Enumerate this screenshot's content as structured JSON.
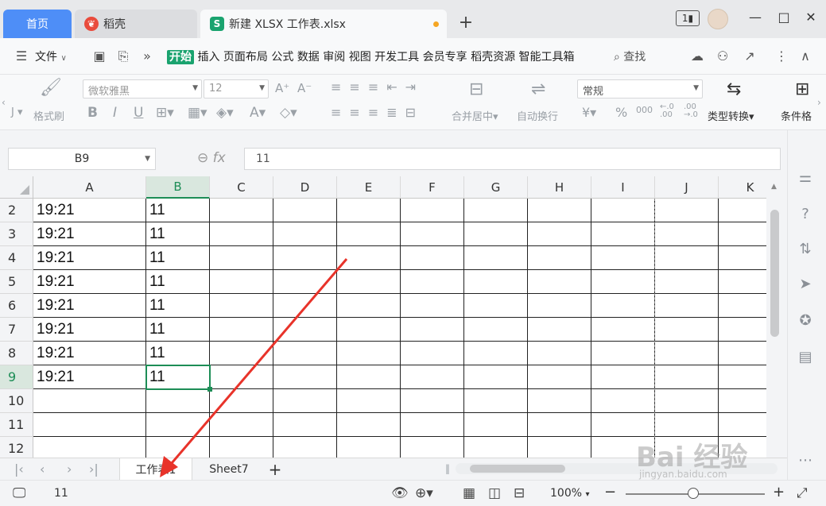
{
  "titlebar": {
    "home_tab": "首页",
    "tabs": [
      {
        "label": "稻壳",
        "icon": "daoke-icon",
        "color": "#e94b3c"
      },
      {
        "label": "新建 XLSX 工作表.xlsx",
        "icon": "spreadsheet-icon",
        "color": "#1aa36f"
      }
    ],
    "badge": "1",
    "minimize": "—",
    "maximize": "□",
    "close": "✕"
  },
  "menubar": {
    "file_label": "文件",
    "tabs": [
      "开始",
      "插入",
      "页面布局",
      "公式",
      "数据",
      "审阅",
      "视图",
      "开发工具",
      "会员专享",
      "稻壳资源",
      "智能工具箱"
    ],
    "active_tab": "开始",
    "search_label": "查找"
  },
  "ribbon": {
    "format_painter": "格式刷",
    "font_name": "微软雅黑",
    "font_size": "12",
    "merge_center": "合并居中",
    "wrap_text": "自动换行",
    "number_format": "常规",
    "type_convert": "类型转换",
    "conditional_format": "条件格"
  },
  "formula_bar": {
    "name_box": "B9",
    "formula": "11",
    "fx_label": "fx"
  },
  "grid": {
    "columns": [
      "A",
      "B",
      "C",
      "D",
      "E",
      "F",
      "G",
      "H",
      "I",
      "J",
      "K"
    ],
    "selected_column": "B",
    "rows": [
      {
        "num": "2",
        "a": "19:21",
        "b": "11"
      },
      {
        "num": "3",
        "a": "19:21",
        "b": "11"
      },
      {
        "num": "4",
        "a": "19:21",
        "b": "11"
      },
      {
        "num": "5",
        "a": "19:21",
        "b": "11"
      },
      {
        "num": "6",
        "a": "19:21",
        "b": "11"
      },
      {
        "num": "7",
        "a": "19:21",
        "b": "11"
      },
      {
        "num": "8",
        "a": "19:21",
        "b": "11"
      },
      {
        "num": "9",
        "a": "19:21",
        "b": "11"
      },
      {
        "num": "10",
        "a": "",
        "b": ""
      },
      {
        "num": "11",
        "a": "",
        "b": ""
      },
      {
        "num": "12",
        "a": "",
        "b": ""
      }
    ],
    "selected_row": "9"
  },
  "sheets": {
    "tabs": [
      "工作表1",
      "Sheet7"
    ],
    "active": "工作表1"
  },
  "statusbar": {
    "value": "11",
    "zoom": "100%"
  },
  "watermark": {
    "main": "Bai 经验",
    "sub": "jingyan.baidu.com"
  },
  "colors": {
    "accent": "#1d8d56",
    "home_tab": "#4e8ef7",
    "annotation_arrow": "#e8332a"
  }
}
